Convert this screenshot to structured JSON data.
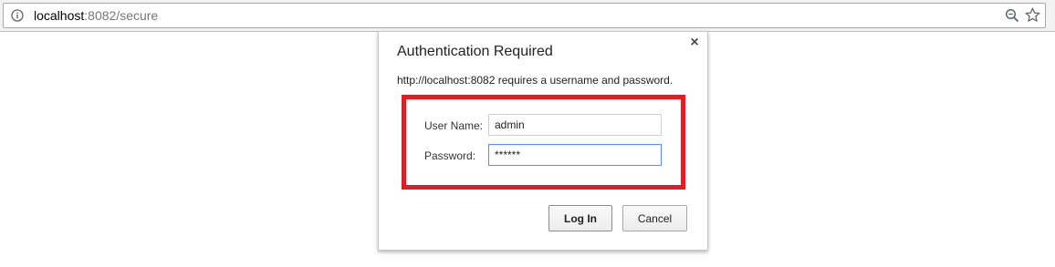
{
  "browser": {
    "url_host": "localhost",
    "url_rest": ":8082/secure",
    "info_icon": "info-icon",
    "zoom_icon": "zoom-icon",
    "star_icon": "star-icon"
  },
  "dialog": {
    "title": "Authentication Required",
    "message": "http://localhost:8082 requires a username and password.",
    "close_glyph": "×",
    "username_label": "User Name:",
    "username_value": "admin",
    "password_label": "Password:",
    "password_value": "******",
    "login_label": "Log In",
    "cancel_label": "Cancel",
    "highlight_color": "#e01e26"
  }
}
